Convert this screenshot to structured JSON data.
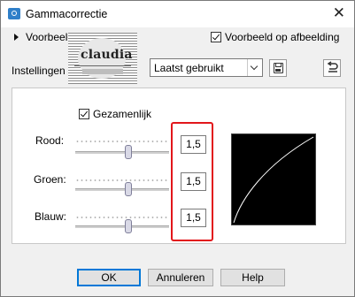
{
  "window": {
    "title": "Gammacorrectie",
    "close_glyph": "✕"
  },
  "preview": {
    "label": "Voorbeeld",
    "on_image_label": "Voorbeeld op afbeelding",
    "on_image_checked": true
  },
  "logo": {
    "text": "claudia"
  },
  "settings": {
    "label": "Instellingen",
    "preset_value": "Laatst gebruikt",
    "save_icon": "floppy-disk-icon",
    "reset_icon": "reset-icon"
  },
  "gamma": {
    "joint_label": "Gezamenlijk",
    "joint_checked": true,
    "rows": [
      {
        "label": "Rood:",
        "value": "1,5"
      },
      {
        "label": "Groen:",
        "value": "1,5"
      },
      {
        "label": "Blauw:",
        "value": "1,5"
      }
    ]
  },
  "buttons": {
    "ok": "OK",
    "cancel": "Annuleren",
    "help": "Help"
  },
  "colors": {
    "highlight_border": "#e2161b",
    "ok_border": "#0078d7",
    "curve_background": "#000000",
    "curve_line": "#ffffff"
  }
}
